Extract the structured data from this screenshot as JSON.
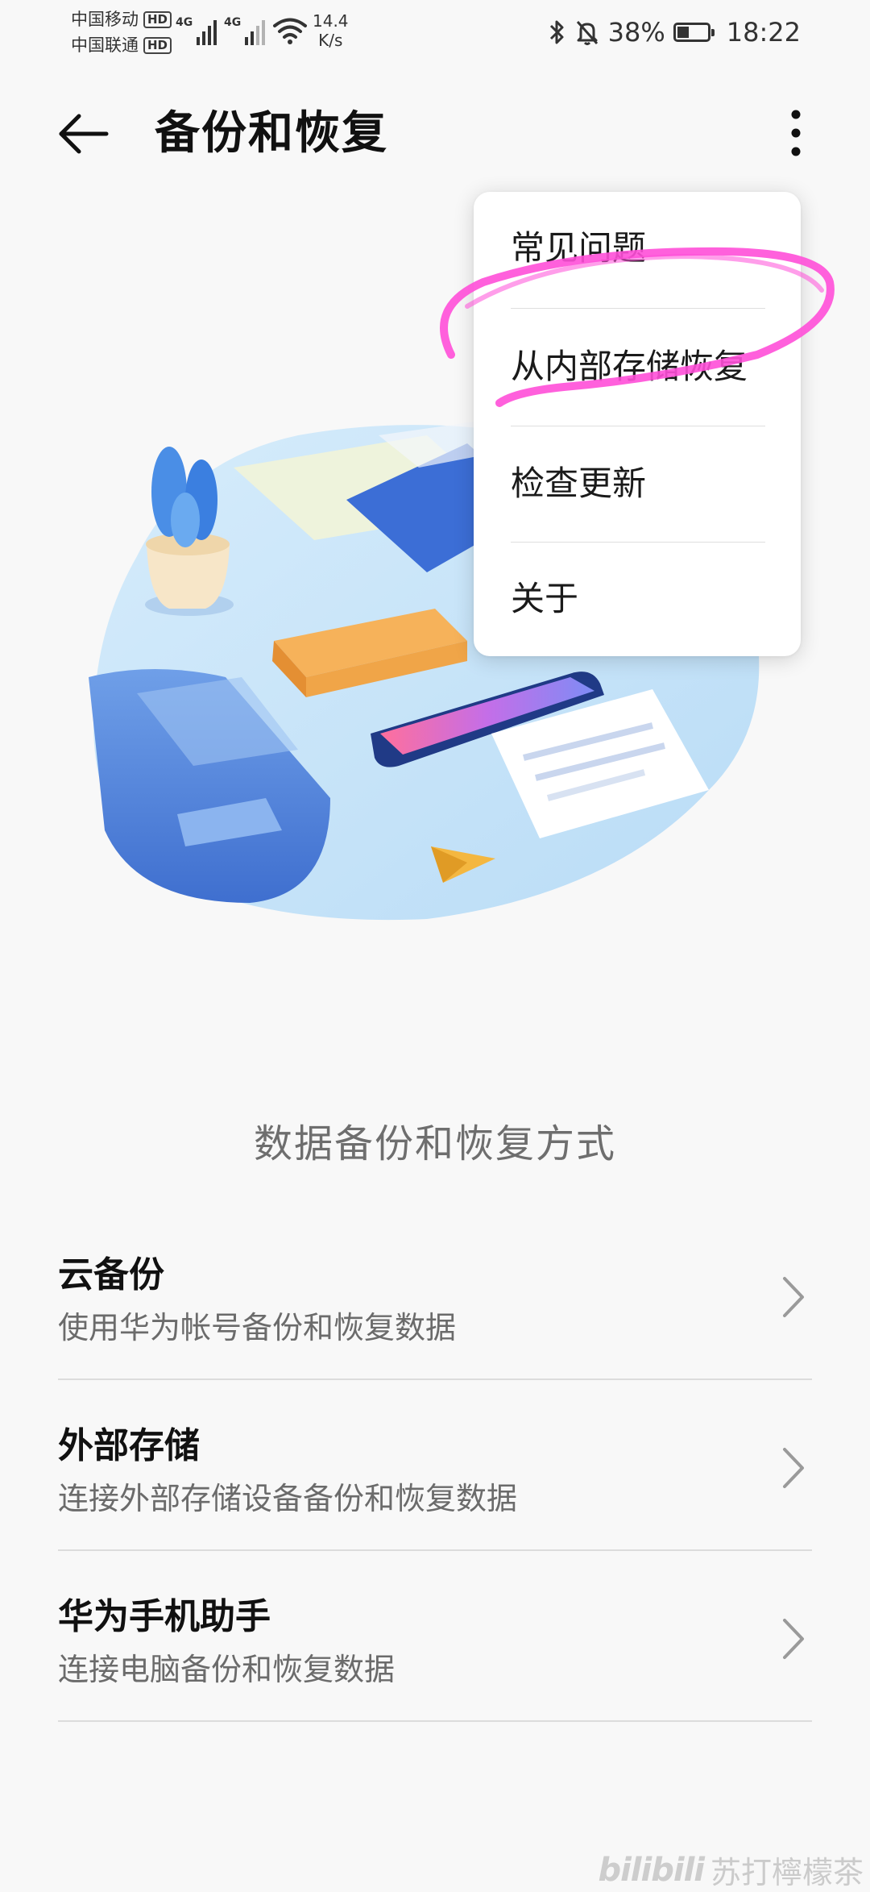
{
  "status_bar": {
    "carrier_1": "中国移动",
    "carrier_2": "中国联通",
    "hd_badge": "HD",
    "network_type": "4G",
    "net_speed_value": "14.4",
    "net_speed_unit": "K/s",
    "battery": "38%",
    "time": "18:22",
    "battery_level": 0.38
  },
  "app_bar": {
    "title": "备份和恢复",
    "back_icon": "arrow-left-icon",
    "more_icon": "more-vertical-icon"
  },
  "menu": {
    "items": [
      {
        "label": "常见问题"
      },
      {
        "label": "从内部存储恢复"
      },
      {
        "label": "检查更新"
      },
      {
        "label": "关于"
      }
    ],
    "highlight_color": "#ff4fd8"
  },
  "section_title": "数据备份和恢复方式",
  "options": [
    {
      "title": "云备份",
      "subtitle": "使用华为帐号备份和恢复数据"
    },
    {
      "title": "外部存储",
      "subtitle": "连接外部存储设备备份和恢复数据"
    },
    {
      "title": "华为手机助手",
      "subtitle": "连接电脑备份和恢复数据"
    }
  ],
  "watermark": {
    "logo": "bilibili",
    "text": "苏打檸檬茶"
  }
}
